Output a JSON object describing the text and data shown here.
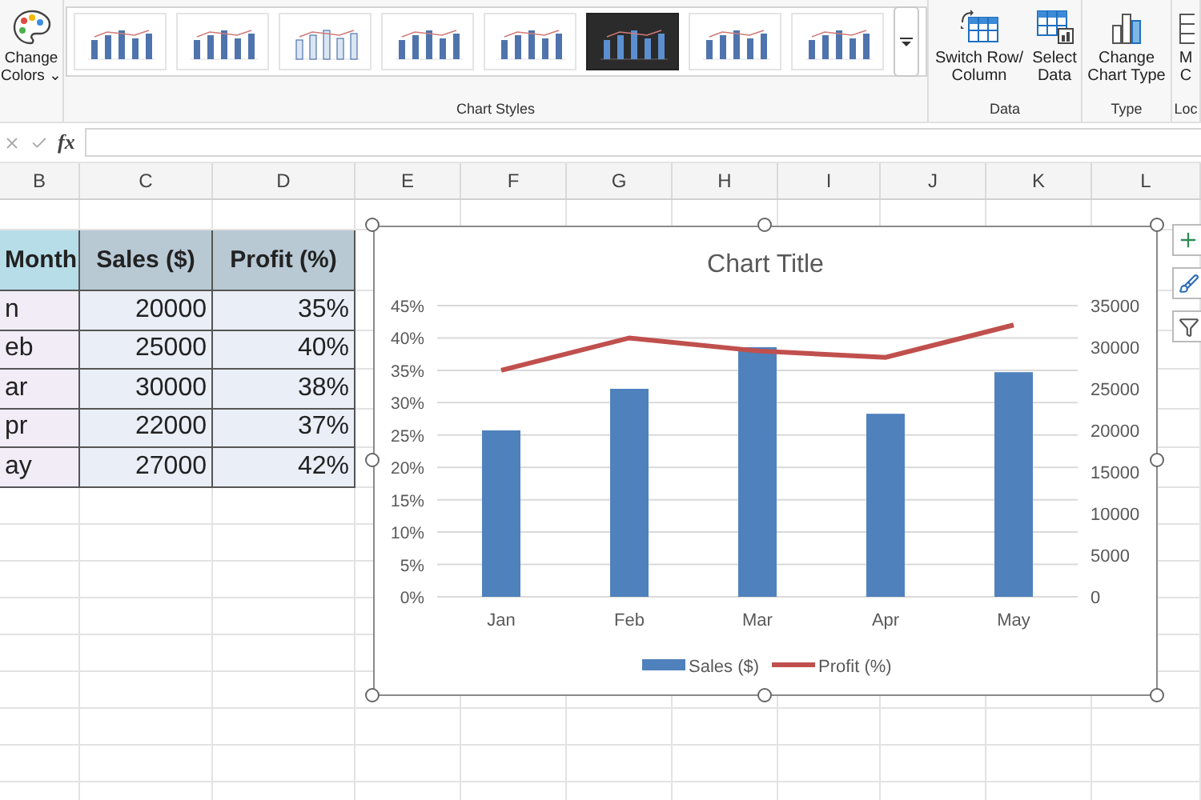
{
  "ribbon": {
    "change_colors": {
      "label": "Change Colors",
      "caret": "⌄"
    },
    "chart_styles": {
      "label": "Chart Styles",
      "thumbnails": [
        {
          "kind": "light"
        },
        {
          "kind": "light"
        },
        {
          "kind": "outline"
        },
        {
          "kind": "light"
        },
        {
          "kind": "light"
        },
        {
          "kind": "dark"
        },
        {
          "kind": "light"
        },
        {
          "kind": "light"
        }
      ]
    },
    "data_group": {
      "label": "Data",
      "buttons": [
        {
          "label": "Switch Row/ Column",
          "kind": "switch"
        },
        {
          "label": "Select Data",
          "kind": "select"
        }
      ]
    },
    "type_group": {
      "label": "Type",
      "buttons": [
        {
          "label": "Change Chart Type",
          "kind": "type"
        }
      ]
    },
    "cut_group": {
      "label": "Loc",
      "buttons": [
        {
          "label": "M C",
          "kind": "move"
        }
      ]
    }
  },
  "formula_bar": {
    "fx": "fx"
  },
  "columns": [
    "B",
    "C",
    "D",
    "E",
    "F",
    "G",
    "H",
    "I",
    "J",
    "K",
    "L"
  ],
  "table": {
    "header": [
      "Month",
      "Sales ($)",
      "Profit (%)"
    ],
    "rows": [
      [
        "n",
        "20000",
        "35%"
      ],
      [
        "eb",
        "25000",
        "40%"
      ],
      [
        "ar",
        "30000",
        "38%"
      ],
      [
        "pr",
        "22000",
        "37%"
      ],
      [
        "ay",
        "27000",
        "42%"
      ]
    ]
  },
  "chart": {
    "chart_data": {
      "type": "bar",
      "title": "Chart Title",
      "categories": [
        "Jan",
        "Feb",
        "Mar",
        "Apr",
        "May"
      ],
      "series": [
        {
          "name": "Sales ($)",
          "color": "#4f81bd",
          "type": "bar",
          "axis": "y2",
          "values": [
            20000,
            25000,
            30000,
            22000,
            27000
          ]
        },
        {
          "name": "Profit (%)",
          "color": "#c0504d",
          "type": "line",
          "values": [
            35,
            40,
            38,
            37,
            42
          ]
        }
      ],
      "ylim": [
        0,
        45
      ],
      "yticks": [
        {
          "value": 0,
          "label": "0%"
        },
        {
          "value": 5,
          "label": "5%"
        },
        {
          "value": 10,
          "label": "10%"
        },
        {
          "value": 15,
          "label": "15%"
        },
        {
          "value": 20,
          "label": "20%"
        },
        {
          "value": 25,
          "label": "25%"
        },
        {
          "value": 30,
          "label": "30%"
        },
        {
          "value": 35,
          "label": "35%"
        },
        {
          "value": 40,
          "label": "40%"
        },
        {
          "value": 45,
          "label": "45%"
        }
      ],
      "grid": true,
      "legend": true,
      "y2lim": [
        0,
        35000
      ],
      "y2ticks": [
        {
          "value": 0,
          "label": "0"
        },
        {
          "value": 5000,
          "label": "5000"
        },
        {
          "value": 10000,
          "label": "10000"
        },
        {
          "value": 15000,
          "label": "15000"
        },
        {
          "value": 20000,
          "label": "20000"
        },
        {
          "value": 25000,
          "label": "25000"
        },
        {
          "value": 30000,
          "label": "30000"
        },
        {
          "value": 35000,
          "label": "35000"
        }
      ]
    }
  }
}
